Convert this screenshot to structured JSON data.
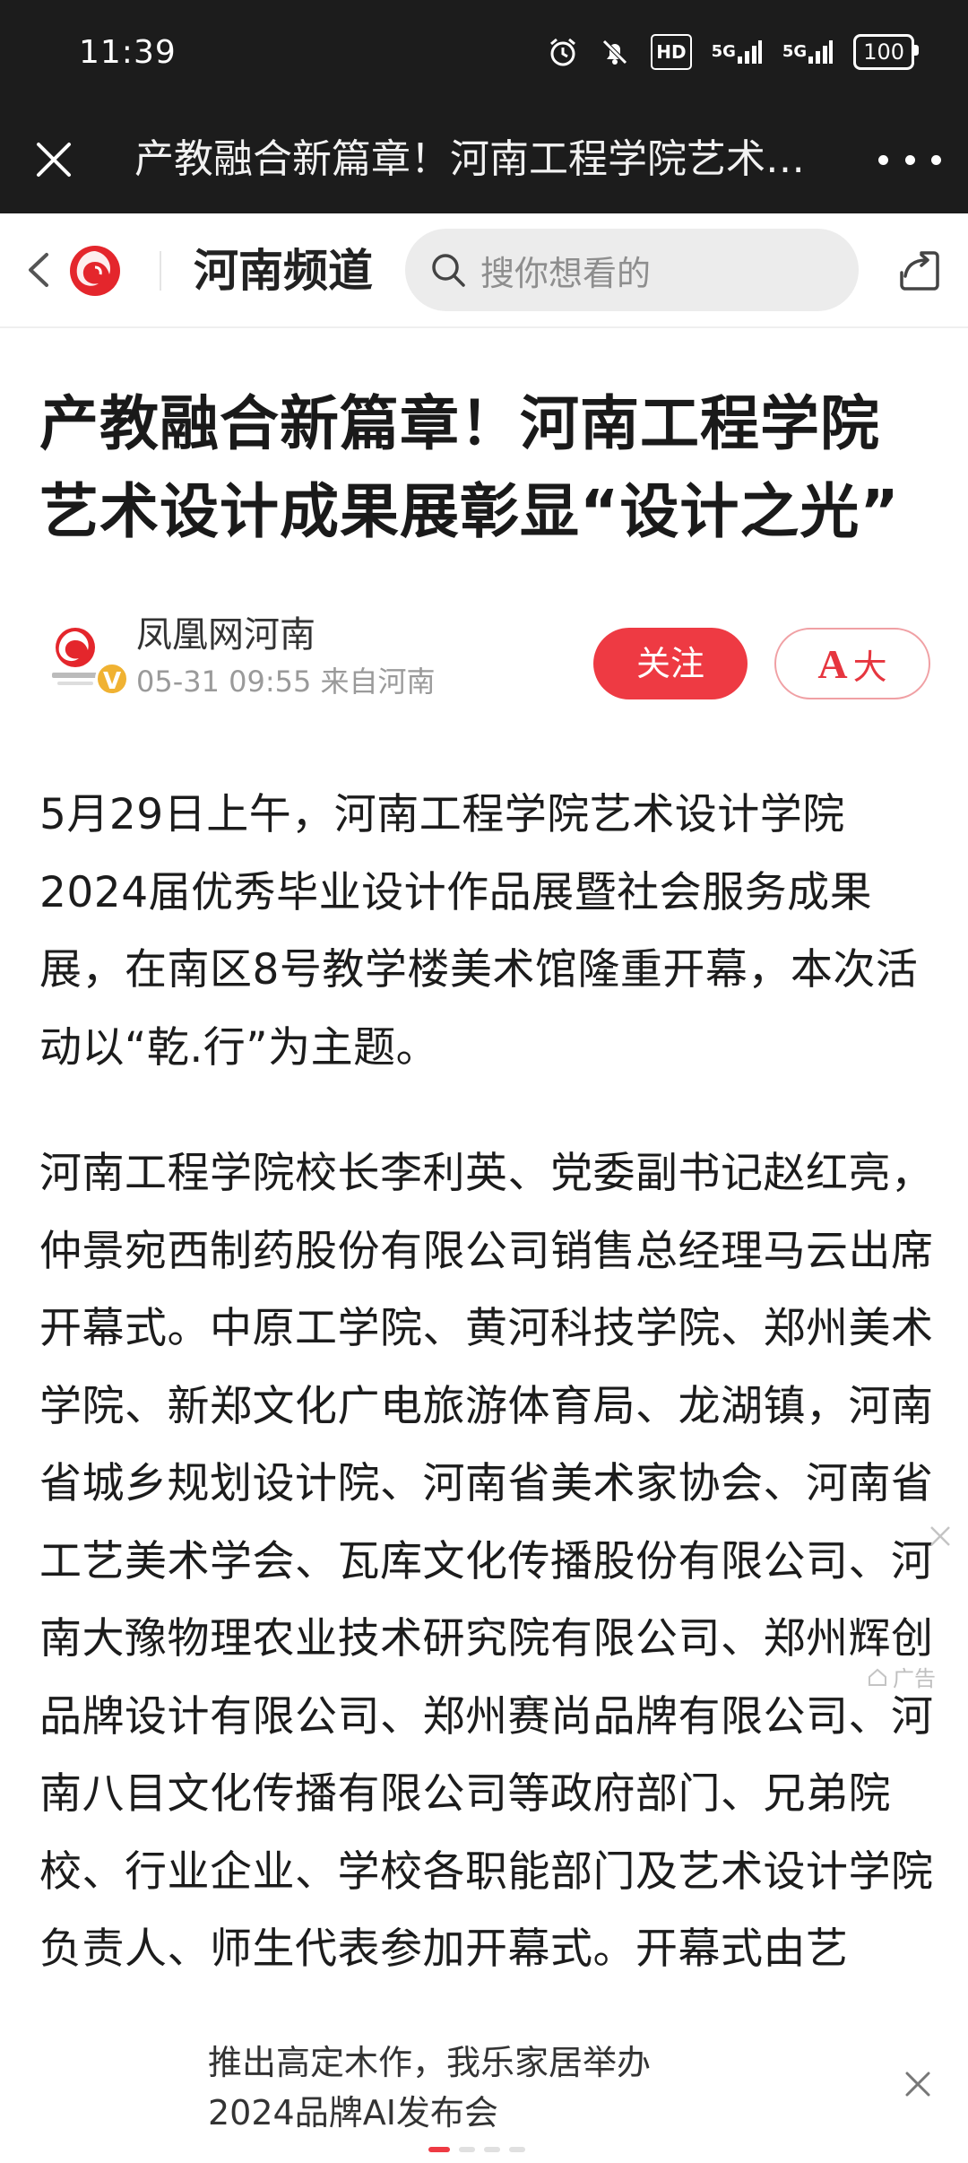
{
  "status_bar": {
    "time": "11:39",
    "hd_label": "HD",
    "signal_1": "5G",
    "signal_2": "5G",
    "battery": "100"
  },
  "webview": {
    "title": "产教融合新篇章！河南工程学院艺术设计成果展彰显“设计之光”"
  },
  "header": {
    "channel": "河南频道",
    "search_placeholder": "搜你想看的"
  },
  "article": {
    "headline": "产教融合新篇章！河南工程学院艺术设计成果展彰显“设计之光”",
    "author": {
      "name": "凤凰网河南",
      "meta": "05-31 09:55 来自河南",
      "verified_badge": "V",
      "follow_label": "关注",
      "font_size_label": "大"
    },
    "paragraphs": [
      "5月29日上午，河南工程学院艺术设计学院2024届优秀毕业设计作品展暨社会服务成果展，在南区8号教学楼美术馆隆重开幕，本次活动以“乾.行”为主题。",
      "河南工程学院校长李利英、党委副书记赵红亮，仲景宛西制药股份有限公司销售总经理马云出席开幕式。中原工学院、黄河科技学院、郑州美术学院、新郑文化广电旅游体育局、龙湖镇，河南省城乡规划设计院、河南省美术家协会、河南省工艺美术学会、瓦库文化传播股份有限公司、河南大豫物理农业技术研究院有限公司、郑州辉创品牌设计有限公司、郑州赛尚品牌有限公司、河南八目文化传播有限公司等政府部门、兄弟院校、行业企业、学校各职能部门及艺术设计学院负责人、师生代表参加开幕式。开幕式由艺"
    ],
    "ad_label": "广告"
  },
  "banner": {
    "text": "推出高定木作，我乐家居举办2024品牌AI发布会"
  },
  "colors": {
    "accent": "#ee3a43",
    "status_bg": "#1c1c1c"
  }
}
